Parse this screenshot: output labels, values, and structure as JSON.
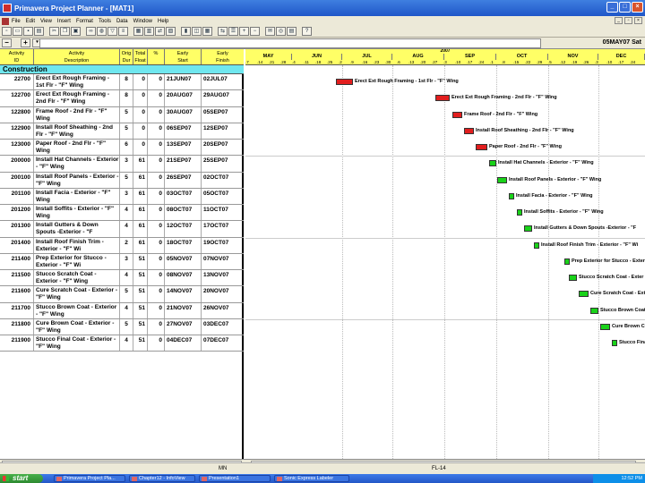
{
  "window": {
    "title": "Primavera Project Planner - [MAT1]"
  },
  "menu": [
    "File",
    "Edit",
    "View",
    "Insert",
    "Format",
    "Tools",
    "Data",
    "Window",
    "Help"
  ],
  "editbar": {
    "date": "05MAY07 Sat"
  },
  "columns": [
    [
      "Activity",
      "ID"
    ],
    [
      "Activity",
      "Description"
    ],
    [
      "Orig",
      "Dur"
    ],
    [
      "Total",
      "Float"
    ],
    [
      "%",
      ""
    ],
    [
      "Early",
      "Start"
    ],
    [
      "Early",
      "Finish"
    ]
  ],
  "group": "Construction",
  "rows": [
    {
      "id": "22700",
      "desc": "Erect Ext Rough Framing - 1st Flr - \"F\" Wing",
      "dur": "8",
      "float": "0",
      "pct": "0",
      "start": "21JUN07",
      "finish": "02JUL07"
    },
    {
      "id": "122700",
      "desc": "Erect Ext Rough Framing - 2nd Flr - \"F\" Wing",
      "dur": "8",
      "float": "0",
      "pct": "0",
      "start": "20AUG07",
      "finish": "29AUG07"
    },
    {
      "id": "122800",
      "desc": "Frame Roof - 2nd Flr - \"F\" Wing",
      "dur": "5",
      "float": "0",
      "pct": "0",
      "start": "30AUG07",
      "finish": "05SEP07"
    },
    {
      "id": "122900",
      "desc": "Install Roof Sheathing - 2nd Flr - \"F\" Wing",
      "dur": "5",
      "float": "0",
      "pct": "0",
      "start": "06SEP07",
      "finish": "12SEP07"
    },
    {
      "id": "123000",
      "desc": "Paper Roof - 2nd Flr - \"F\" Wing",
      "dur": "6",
      "float": "0",
      "pct": "0",
      "start": "13SEP07",
      "finish": "20SEP07"
    },
    {
      "id": "200000",
      "desc": "Install Hat Channels - Exterior - \"F\" Wing",
      "dur": "3",
      "float": "61",
      "pct": "0",
      "start": "21SEP07",
      "finish": "25SEP07"
    },
    {
      "id": "200100",
      "desc": "Install Roof Panels - Exterior - \"F\" Wing",
      "dur": "5",
      "float": "61",
      "pct": "0",
      "start": "26SEP07",
      "finish": "02OCT07"
    },
    {
      "id": "201100",
      "desc": "Install Facia - Exterior - \"F\" Wing",
      "dur": "3",
      "float": "61",
      "pct": "0",
      "start": "03OCT07",
      "finish": "05OCT07"
    },
    {
      "id": "201200",
      "desc": "Install Soffits - Exterior - \"F\" Wing",
      "dur": "4",
      "float": "61",
      "pct": "0",
      "start": "08OCT07",
      "finish": "11OCT07"
    },
    {
      "id": "201300",
      "desc": "Install Gutters & Down Spouts -Exterior - \"F",
      "dur": "4",
      "float": "61",
      "pct": "0",
      "start": "12OCT07",
      "finish": "17OCT07"
    },
    {
      "id": "201400",
      "desc": "Install Roof Finish Trim - Exterior - \"F\" Wi",
      "dur": "2",
      "float": "61",
      "pct": "0",
      "start": "18OCT07",
      "finish": "19OCT07"
    },
    {
      "id": "211400",
      "desc": "Prep Exterior for Stucco - Exterior - \"F\" Wi",
      "dur": "3",
      "float": "51",
      "pct": "0",
      "start": "05NOV07",
      "finish": "07NOV07"
    },
    {
      "id": "211500",
      "desc": "Stucco Scratch Coat - Exterior - \"F\" Wing",
      "dur": "4",
      "float": "51",
      "pct": "0",
      "start": "08NOV07",
      "finish": "13NOV07"
    },
    {
      "id": "211600",
      "desc": "Cure Scratch Coat - Exterior - \"F\" Wing",
      "dur": "5",
      "float": "51",
      "pct": "0",
      "start": "14NOV07",
      "finish": "20NOV07"
    },
    {
      "id": "211700",
      "desc": "Stucco Brown Coat - Exterior - \"F\" Wing",
      "dur": "4",
      "float": "51",
      "pct": "0",
      "start": "21NOV07",
      "finish": "26NOV07"
    },
    {
      "id": "211800",
      "desc": "Cure Brown Coat - Exterior - \"F\" Wing",
      "dur": "5",
      "float": "51",
      "pct": "0",
      "start": "27NOV07",
      "finish": "03DEC07"
    },
    {
      "id": "211900",
      "desc": "Stucco Final Coat - Exterior - \"F\" Wing",
      "dur": "4",
      "float": "51",
      "pct": "0",
      "start": "04DEC07",
      "finish": "07DEC07"
    }
  ],
  "gantt": {
    "year": "2007",
    "months": [
      "MAY",
      "JUN",
      "JUL",
      "AUG",
      "SEP",
      "OCT",
      "NOV",
      "DEC"
    ],
    "days": [
      ".7",
      ".14",
      ".21",
      ".28",
      ".4",
      ".11",
      ".18",
      ".25",
      ".2",
      ".9",
      ".16",
      ".23",
      ".30",
      ".6",
      ".13",
      ".20",
      ".27",
      ".3",
      ".10",
      ".17",
      ".24",
      ".1",
      ".8",
      ".15",
      ".22",
      ".29",
      ".5",
      ".12",
      ".19",
      ".26",
      ".3",
      ".10",
      ".17",
      ".24"
    ],
    "labels": [
      "Erect Ext Rough Framing - 1st Flr - \"F\" Wing",
      "Erect Ext Rough Framing - 2nd Flr - \"F\" Wing",
      "Frame Roof - 2nd Flr - \"F\" Wing",
      "Install Roof Sheathing - 2nd Flr - \"F\" Wing",
      "Paper Roof - 2nd Flr - \"F\" Wing",
      "Install Hat Channels - Exterior - \"F\" Wing",
      "Install Roof Panels - Exterior - \"F\" Wing",
      "Install Facia - Exterior - \"F\" Wing",
      "Install Soffits - Exterior - \"F\" Wing",
      "Install Gutters & Down Spouts -Exterior - \"F",
      "Install Roof Finish Trim - Exterior - \"F\" Wi",
      "Prep Exterior for Stucco - Exterior",
      "Stucco Scratch Coat - Exter",
      "Cure Scratch Coat - Ext",
      "Stucco Brown Coat",
      "Cure Brown C",
      "Stucco Final"
    ],
    "critical": [
      true,
      true,
      true,
      true,
      true,
      false,
      false,
      false,
      false,
      false,
      false,
      false,
      false,
      false,
      false,
      false,
      false
    ]
  },
  "status": {
    "left": "MN",
    "right": "FL-14"
  },
  "taskbar": {
    "start": "start",
    "tasks": [
      "Primavera Project Pla...",
      "Chapter12 - InfoView",
      "Presentation1",
      "Sonic Express Labeler"
    ],
    "clock": "12:52 PM"
  },
  "colors": {
    "critical": "#e21e1e",
    "noncritical": "#19d219",
    "header": "#ffff66",
    "group": "#6fe7ef"
  }
}
